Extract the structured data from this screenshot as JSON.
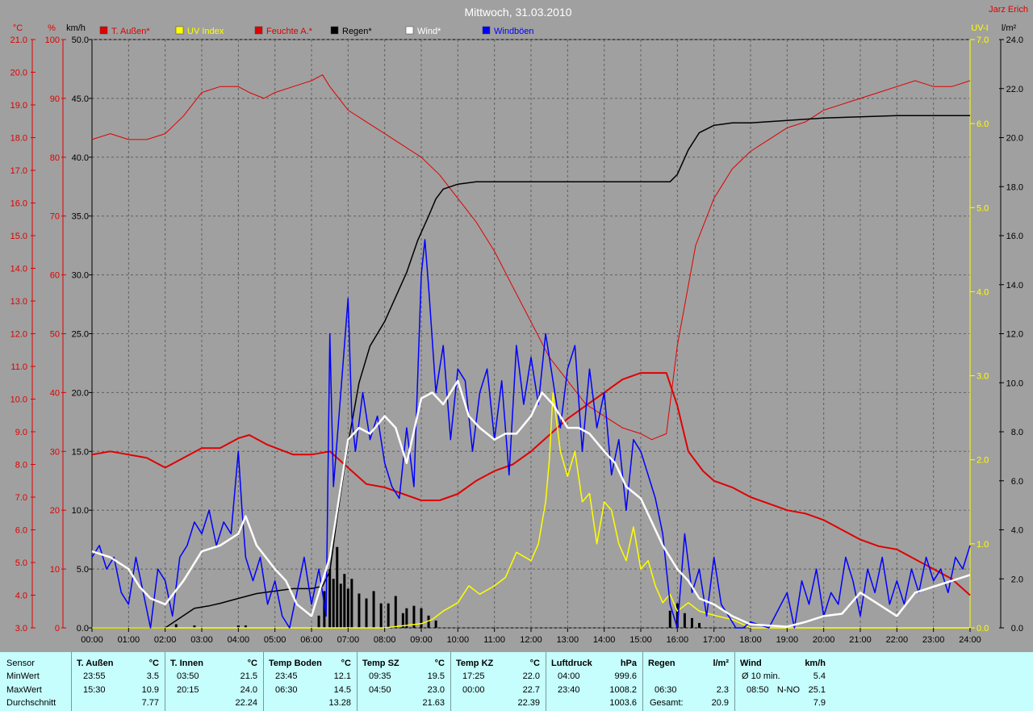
{
  "title": "Mittwoch, 31.03.2010",
  "author": "Jarz Erich",
  "colors": {
    "temp": "#e00000",
    "uv": "#ffff00",
    "humidity": "#e00000",
    "rain": "#000000",
    "wind": "#ffffff",
    "gust": "#0000ff",
    "bg": "#a0a0a0",
    "plot": "#a0a0a0"
  },
  "axis_units": {
    "temp": "°C",
    "humidity": "%",
    "wind": "km/h",
    "uv": "UV-I",
    "rain": "l/m²"
  },
  "chart_data": {
    "type": "line",
    "title": "Mittwoch, 31.03.2010",
    "grid": true,
    "legend_placement": "top",
    "xlim": [
      0,
      24
    ],
    "x_ticks": [
      "00:00",
      "01:00",
      "02:00",
      "03:00",
      "04:00",
      "05:00",
      "06:00",
      "07:00",
      "08:00",
      "09:00",
      "10:00",
      "11:00",
      "12:00",
      "13:00",
      "14:00",
      "15:00",
      "16:00",
      "17:00",
      "18:00",
      "19:00",
      "20:00",
      "21:00",
      "22:00",
      "23:00",
      "24:00"
    ],
    "axes": {
      "temp": {
        "label": "°C",
        "ylim": [
          3,
          21
        ],
        "ticks": [
          "3.0",
          "4.0",
          "5.0",
          "6.0",
          "7.0",
          "8.0",
          "9.0",
          "10.0",
          "11.0",
          "12.0",
          "13.0",
          "14.0",
          "15.0",
          "16.0",
          "17.0",
          "18.0",
          "19.0",
          "20.0",
          "21.0"
        ]
      },
      "humidity": {
        "label": "%",
        "ylim": [
          0,
          100
        ],
        "ticks": [
          "0",
          "10",
          "20",
          "30",
          "40",
          "50",
          "60",
          "70",
          "80",
          "90",
          "100"
        ]
      },
      "wind": {
        "label": "km/h",
        "ylim": [
          0,
          50
        ],
        "ticks": [
          "0.0",
          "5.0",
          "10.0",
          "15.0",
          "20.0",
          "25.0",
          "30.0",
          "35.0",
          "40.0",
          "45.0",
          "50.0"
        ]
      },
      "uv": {
        "label": "UV-I",
        "ylim": [
          0,
          7
        ],
        "ticks": [
          "0.0",
          "1.0",
          "2.0",
          "3.0",
          "4.0",
          "5.0",
          "6.0",
          "7.0"
        ]
      },
      "rain": {
        "label": "l/m²",
        "ylim": [
          0,
          24
        ],
        "ticks": [
          "0.0",
          "2.0",
          "4.0",
          "6.0",
          "8.0",
          "10.0",
          "12.0",
          "14.0",
          "16.0",
          "18.0",
          "20.0",
          "22.0",
          "24.0"
        ]
      }
    },
    "series": [
      {
        "name": "T. Außen*",
        "axis": "temp",
        "color": "#e00000",
        "width": 2,
        "x": [
          0,
          0.5,
          1,
          1.5,
          2,
          2.5,
          3,
          3.5,
          4,
          4.3,
          4.8,
          5.5,
          6,
          6.5,
          7,
          7.5,
          8,
          8.5,
          9,
          9.5,
          10,
          10.5,
          11,
          11.5,
          12,
          12.5,
          13,
          13.5,
          14,
          14.5,
          15,
          15.5,
          15.7,
          16,
          16.3,
          16.7,
          17,
          17.5,
          18,
          18.5,
          19,
          19.5,
          20,
          20.5,
          21,
          21.5,
          22,
          22.5,
          23,
          23.5,
          24
        ],
        "y": [
          8.3,
          8.4,
          8.3,
          8.2,
          7.9,
          8.2,
          8.5,
          8.5,
          8.8,
          8.9,
          8.6,
          8.3,
          8.3,
          8.4,
          7.9,
          7.4,
          7.3,
          7.1,
          6.9,
          6.9,
          7.1,
          7.5,
          7.8,
          8.0,
          8.4,
          8.9,
          9.4,
          9.8,
          10.2,
          10.6,
          10.8,
          10.8,
          10.8,
          9.8,
          8.4,
          7.8,
          7.5,
          7.3,
          7.0,
          6.8,
          6.6,
          6.5,
          6.3,
          6.0,
          5.7,
          5.5,
          5.4,
          5.1,
          4.8,
          4.5,
          4.0
        ]
      },
      {
        "name": "Feuchte A.*",
        "axis": "humidity",
        "color": "#e00000",
        "width": 1,
        "x": [
          0,
          0.5,
          1,
          1.5,
          2,
          2.5,
          3,
          3.5,
          4,
          4.3,
          4.7,
          5,
          5.5,
          6,
          6.3,
          6.5,
          7,
          7.5,
          8,
          8.5,
          9,
          9.5,
          10,
          10.5,
          11,
          11.5,
          12,
          12.5,
          13,
          13.5,
          14,
          14.5,
          15,
          15.3,
          15.7,
          16,
          16.5,
          17,
          17.5,
          18,
          18.5,
          19,
          19.5,
          20,
          20.5,
          21,
          21.5,
          22,
          22.5,
          23,
          23.5,
          24
        ],
        "y": [
          83,
          84,
          83,
          83,
          84,
          87,
          91,
          92,
          92,
          91,
          90,
          91,
          92,
          93,
          94,
          92,
          88,
          86,
          84,
          82,
          80,
          77,
          73,
          69,
          64,
          58,
          52,
          46,
          42,
          38,
          36,
          34,
          33,
          32,
          33,
          48,
          65,
          73,
          78,
          81,
          83,
          85,
          86,
          88,
          89,
          90,
          91,
          92,
          93,
          92,
          92,
          93
        ]
      },
      {
        "name": "Regen*",
        "axis": "rain",
        "color": "#000000",
        "width": 1.5,
        "x": [
          0,
          2,
          2.3,
          2.8,
          3.2,
          3.5,
          4,
          4.5,
          5,
          5.5,
          6,
          6.3,
          6.5,
          6.7,
          7,
          7.3,
          7.6,
          8,
          8.3,
          8.6,
          8.9,
          9.2,
          9.4,
          9.6,
          10,
          10.5,
          11,
          12,
          13,
          14,
          15,
          15.8,
          16,
          16.3,
          16.6,
          17,
          17.5,
          18,
          19,
          20,
          21,
          22,
          23,
          24
        ],
        "y": [
          0,
          0,
          0.3,
          0.8,
          0.9,
          1.0,
          1.2,
          1.4,
          1.5,
          1.6,
          1.6,
          1.7,
          2.3,
          4.5,
          7.5,
          10.0,
          11.5,
          12.5,
          13.5,
          14.5,
          15.8,
          16.8,
          17.5,
          17.9,
          18.1,
          18.2,
          18.2,
          18.2,
          18.2,
          18.2,
          18.2,
          18.2,
          18.5,
          19.5,
          20.2,
          20.5,
          20.6,
          20.6,
          20.7,
          20.8,
          20.85,
          20.9,
          20.9,
          20.9
        ]
      },
      {
        "name": "Wind*",
        "axis": "wind",
        "color": "#ffffff",
        "width": 2.5,
        "x": [
          0,
          0.5,
          1,
          1.3,
          1.6,
          2,
          2.5,
          3,
          3.5,
          4,
          4.2,
          4.5,
          5,
          5.3,
          5.6,
          6,
          6.3,
          6.5,
          6.8,
          7,
          7.3,
          7.6,
          8,
          8.3,
          8.6,
          9,
          9.3,
          9.6,
          10,
          10.3,
          10.6,
          11,
          11.3,
          11.6,
          12,
          12.3,
          12.6,
          13,
          13.3,
          13.6,
          14,
          14.3,
          14.6,
          15,
          15.3,
          15.6,
          16,
          16.3,
          16.6,
          17,
          17.5,
          18,
          18.5,
          19,
          19.5,
          20,
          20.5,
          21,
          21.5,
          22,
          22.5,
          23,
          23.5,
          24
        ],
        "y": [
          6.5,
          6,
          5,
          3.5,
          2.5,
          2,
          4,
          6.5,
          7,
          8,
          9.5,
          7,
          5,
          4,
          2,
          1,
          4,
          6,
          12,
          16,
          17,
          16.5,
          18,
          17,
          14,
          19.5,
          20,
          19,
          21,
          18,
          17,
          16,
          16.5,
          16.5,
          18,
          20,
          19,
          17,
          17,
          16.5,
          15,
          14,
          12,
          11,
          9,
          7,
          5,
          4,
          2.5,
          2,
          1,
          0.3,
          0.2,
          0.1,
          0.5,
          1,
          1.2,
          3,
          2,
          1,
          3,
          3.5,
          4,
          4.5
        ]
      },
      {
        "name": "Windböen",
        "axis": "wind",
        "color": "#0000ff",
        "width": 1.5,
        "x": [
          0,
          0.2,
          0.4,
          0.6,
          0.8,
          1,
          1.2,
          1.4,
          1.6,
          1.8,
          2,
          2.2,
          2.4,
          2.6,
          2.8,
          3,
          3.2,
          3.4,
          3.6,
          3.8,
          4,
          4.1,
          4.2,
          4.4,
          4.6,
          4.8,
          5,
          5.2,
          5.4,
          5.6,
          5.8,
          6,
          6.2,
          6.4,
          6.5,
          6.6,
          6.8,
          7,
          7.1,
          7.2,
          7.4,
          7.6,
          7.8,
          8,
          8.2,
          8.4,
          8.6,
          8.8,
          9,
          9.1,
          9.2,
          9.4,
          9.6,
          9.8,
          10,
          10.2,
          10.4,
          10.6,
          10.8,
          11,
          11.2,
          11.4,
          11.6,
          11.8,
          12,
          12.2,
          12.4,
          12.6,
          12.8,
          13,
          13.2,
          13.4,
          13.6,
          13.8,
          14,
          14.2,
          14.4,
          14.6,
          14.8,
          15,
          15.2,
          15.4,
          15.6,
          15.8,
          16,
          16.2,
          16.4,
          16.6,
          16.8,
          17,
          17.2,
          17.4,
          17.6,
          17.8,
          18,
          18.5,
          19,
          19.2,
          19.4,
          19.6,
          19.8,
          20,
          20.2,
          20.4,
          20.6,
          20.8,
          21,
          21.2,
          21.4,
          21.6,
          21.8,
          22,
          22.2,
          22.4,
          22.6,
          22.8,
          23,
          23.2,
          23.4,
          23.6,
          23.8,
          24
        ],
        "y": [
          6,
          7,
          5,
          6,
          3,
          2,
          6,
          3,
          0,
          5,
          4,
          1,
          6,
          7,
          9,
          8,
          10,
          7,
          9,
          8,
          15,
          10,
          6,
          4,
          6,
          2,
          4,
          1,
          0,
          3,
          6,
          2,
          5,
          1,
          25,
          12,
          20,
          28,
          18,
          15,
          20,
          16,
          18,
          14,
          12,
          11,
          17,
          12,
          30,
          33,
          29,
          20,
          24,
          16,
          22,
          21,
          15,
          20,
          22,
          16,
          21,
          13,
          24,
          19,
          23,
          19,
          25,
          21,
          17,
          22,
          24,
          15,
          22,
          17,
          20,
          13,
          16,
          10,
          16,
          15,
          13,
          11,
          8,
          2,
          0,
          8,
          3,
          5,
          1,
          6,
          2,
          1,
          0,
          0,
          0.5,
          0,
          3,
          0,
          4,
          2,
          5,
          1,
          3,
          2,
          6,
          4,
          1,
          5,
          3,
          6,
          2,
          4,
          2,
          5,
          3,
          6,
          4,
          5,
          3,
          6,
          5,
          7
        ]
      },
      {
        "name": "UV Index",
        "axis": "uv",
        "color": "#ffff00",
        "width": 1.5,
        "x": [
          0,
          8,
          9,
          9.3,
          9.6,
          10,
          10.3,
          10.6,
          11,
          11.3,
          11.6,
          12,
          12.2,
          12.4,
          12.5,
          12.6,
          12.8,
          13,
          13.2,
          13.4,
          13.6,
          13.8,
          14,
          14.2,
          14.4,
          14.6,
          14.8,
          15,
          15.2,
          15.4,
          15.6,
          15.8,
          16,
          16.3,
          16.6,
          17,
          17.5,
          18,
          24
        ],
        "y": [
          0,
          0,
          0.05,
          0.1,
          0.2,
          0.3,
          0.5,
          0.4,
          0.5,
          0.6,
          0.9,
          0.8,
          1.0,
          1.5,
          2.0,
          2.8,
          2.1,
          1.8,
          2.1,
          1.5,
          1.6,
          1.0,
          1.5,
          1.4,
          1.0,
          0.8,
          1.2,
          0.7,
          0.8,
          0.5,
          0.3,
          0.4,
          0.2,
          0.3,
          0.2,
          0.15,
          0.1,
          0,
          0
        ]
      },
      {
        "name": "Regen (Balken)",
        "legend": false,
        "axis": "rain",
        "type": "bar",
        "color": "#000000",
        "x": [
          2.3,
          2.8,
          4.0,
          4.2,
          6.2,
          6.35,
          6.5,
          6.6,
          6.7,
          6.8,
          6.9,
          7.0,
          7.1,
          7.3,
          7.5,
          7.7,
          7.9,
          8.1,
          8.3,
          8.5,
          8.6,
          8.8,
          9.0,
          9.2,
          9.4,
          15.8,
          16.0,
          16.2,
          16.4,
          16.6
        ],
        "y": [
          0.15,
          0.1,
          0.1,
          0.1,
          0.5,
          1.5,
          2.4,
          2.0,
          3.3,
          1.8,
          2.2,
          1.6,
          2.0,
          1.4,
          1.2,
          1.5,
          1.0,
          1.0,
          1.3,
          0.6,
          0.8,
          0.9,
          0.8,
          0.5,
          0.3,
          0.7,
          1.0,
          0.6,
          0.4,
          0.2
        ]
      }
    ]
  },
  "legend": [
    {
      "label": "T. Außen*",
      "color": "#e00000"
    },
    {
      "label": "UV Index",
      "color": "#ffff00"
    },
    {
      "label": "Feuchte A.*",
      "color": "#e00000"
    },
    {
      "label": "Regen*",
      "color": "#000000"
    },
    {
      "label": "Wind*",
      "color": "#ffffff"
    },
    {
      "label": "Windböen",
      "color": "#0000ff"
    }
  ],
  "stats": {
    "labels": {
      "sensor": "Sensor",
      "min": "MinWert",
      "max": "MaxWert",
      "avg": "Durchschnitt"
    },
    "columns": [
      {
        "name": "T. Außen",
        "unit": "°C",
        "min_time": "23:55",
        "min_val": "3.5",
        "max_time": "15:30",
        "max_val": "10.9",
        "avg": "7.77"
      },
      {
        "name": "T. Innen",
        "unit": "°C",
        "min_time": "03:50",
        "min_val": "21.5",
        "max_time": "20:15",
        "max_val": "24.0",
        "avg": "22.24"
      },
      {
        "name": "Temp Boden",
        "unit": "°C",
        "min_time": "23:45",
        "min_val": "12.1",
        "max_time": "06:30",
        "max_val": "14.5",
        "avg": "13.28"
      },
      {
        "name": "Temp SZ",
        "unit": "°C",
        "min_time": "09:35",
        "min_val": "19.5",
        "max_time": "04:50",
        "max_val": "23.0",
        "avg": "21.63"
      },
      {
        "name": "Temp KZ",
        "unit": "°C",
        "min_time": "17:25",
        "min_val": "22.0",
        "max_time": "00:00",
        "max_val": "22.7",
        "avg": "22.39"
      },
      {
        "name": "Luftdruck",
        "unit": "hPa",
        "min_time": "04:00",
        "min_val": "999.6",
        "max_time": "23:40",
        "max_val": "1008.2",
        "avg": "1003.6"
      },
      {
        "name": "Regen",
        "unit": "l/m²",
        "min_time": "",
        "min_val": "",
        "max_time": "06:30",
        "max_val": "2.3",
        "avg_label": "Gesamt:",
        "avg": "20.9"
      },
      {
        "name": "Wind",
        "unit": "km/h",
        "min_time": "Ø 10 min.",
        "min_val": "5.4",
        "max_time": "08:50",
        "max_dir": "N-NO",
        "max_val": "25.1",
        "avg": "7.9"
      }
    ]
  }
}
